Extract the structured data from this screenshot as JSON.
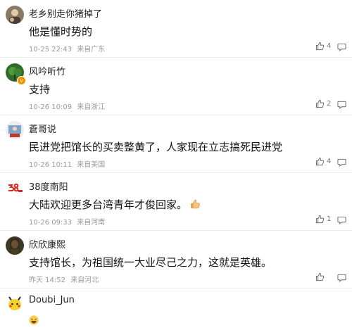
{
  "comments": [
    {
      "username": "老乡别走你猪掉了",
      "text": "他是懂时势的",
      "time": "10-25 22:43",
      "location": "来自广东",
      "likes": "4",
      "avatar": "avatar-photo-mother",
      "verified": false
    },
    {
      "username": "风吟听竹",
      "text": "支持",
      "time": "10-26 10:09",
      "location": "来自浙江",
      "likes": "2",
      "avatar": "avatar-green-tree",
      "verified": true
    },
    {
      "username": "蒼哥说",
      "text": "民进党把馆长的买卖整黄了，人家现在立志搞死民进党",
      "time": "10-26 10:11",
      "location": "来自美国",
      "likes": "4",
      "avatar": "avatar-illustration",
      "verified": false
    },
    {
      "username": "38度南阳",
      "text": "大陆欢迎更多台湾青年才俊回家。",
      "time": "10-26 09:33",
      "location": "来自河南",
      "likes": "1",
      "avatar": "avatar-38-logo",
      "verified": false,
      "emoji": "thumbs-up-emoji"
    },
    {
      "username": "欣欣康熙",
      "text": "支持馆长，为祖国统一大业尽己之力，这就是英雄。",
      "time": "昨天 14:52",
      "location": "来自河北",
      "likes": "",
      "avatar": "avatar-mona-lisa",
      "verified": false
    },
    {
      "username": "Doubi_Jun",
      "text": "",
      "time": "",
      "location": "",
      "likes": "",
      "avatar": "avatar-pikachu",
      "verified": false,
      "emoji": "laughing-emoji"
    }
  ],
  "colors": {
    "meta": "#999999",
    "verified_badge": "#f29100",
    "divider": "#ececec"
  }
}
